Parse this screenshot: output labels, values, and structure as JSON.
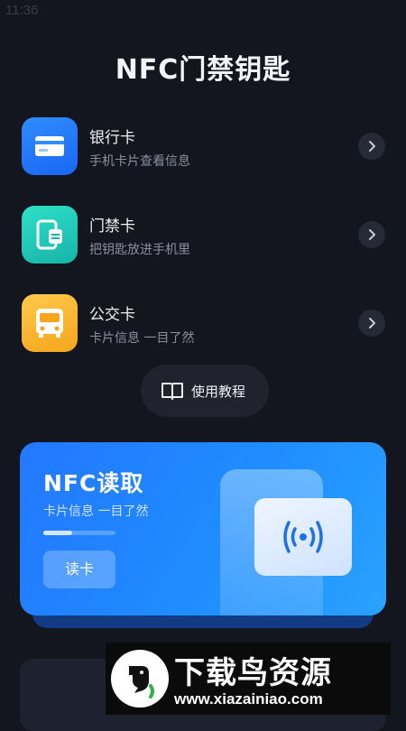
{
  "status_bar": {
    "time": "11:36"
  },
  "page": {
    "title": "NFC门禁钥匙"
  },
  "cards": [
    {
      "title": "银行卡",
      "subtitle": "手机卡片查看信息",
      "icon": "credit-card-icon"
    },
    {
      "title": "门禁卡",
      "subtitle": "把钥匙放进手机里",
      "icon": "access-card-icon"
    },
    {
      "title": "公交卡",
      "subtitle": "卡片信息 一目了然",
      "icon": "bus-icon"
    }
  ],
  "tutorial": {
    "label": "使用教程",
    "icon": "book-icon"
  },
  "nfc_read": {
    "title": "NFC读取",
    "subtitle": "卡片信息 一目了然",
    "button_label": "读卡",
    "progress": 0.4,
    "icon": "nfc-signal-icon"
  },
  "watermark": {
    "title": "下载鸟资源",
    "url": "www.xiazainiao.com"
  },
  "colors": {
    "background": "#13151f",
    "accent_blue": "#2378ff",
    "bank_icon": "#2f8dff",
    "door_icon": "#17b3a8",
    "bus_icon": "#f6a51c"
  }
}
